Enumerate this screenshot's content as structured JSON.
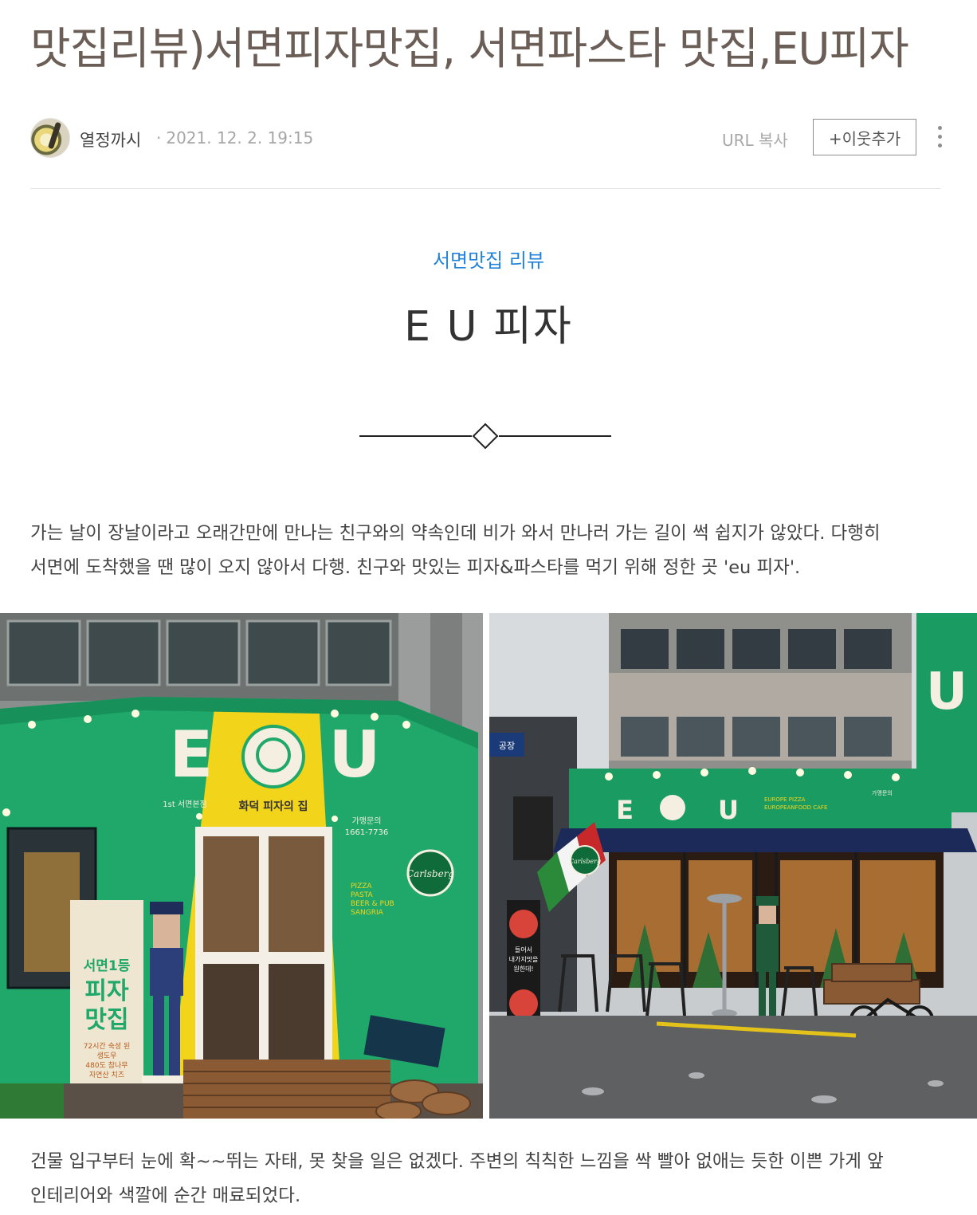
{
  "post": {
    "title": "맛집리뷰)서면피자맛집, 서면파스타 맛집,EU피자",
    "author": "열정까시",
    "date": "2021. 12.  2. 19:15",
    "date_separator": "·",
    "url_copy": "URL 복사",
    "follow_button": "+이웃추가"
  },
  "content": {
    "category": "서면맛집 리뷰",
    "store_name": "E U 피자",
    "paragraph1": [
      "가는 날이 장날이라고  오래간만에 만나는 친구와의 약속인데 비가 와서 만나러 가는 길이 썩 쉽지가 않았다. 다행히",
      "서면에 도착했을 땐  많이 오지 않아서 다행.  친구와  맛있는  피자&파스타를 먹기 위해 정한 곳 'eu 피자'."
    ],
    "paragraph2": [
      " 건물 입구부터 눈에 확~~뛰는 자태, 못 찾을 일은 없겠다. 주변의 칙칙한 느낌을 싹 빨아 없애는 듯한 이쁜 가게 앞",
      "인테리어와  색깔에 순간 매료되었다."
    ]
  },
  "photo1": {
    "letter_e": "E",
    "letter_u": "U",
    "branch": "1st 서면본점",
    "sign": "화덕 피자의 집",
    "phone_label": "가맹문의",
    "phone": "1661-7736",
    "menu": [
      "PIZZA",
      "PASTA",
      "BEER & PUB",
      "SANGRIA"
    ],
    "brand": "Carlsberg",
    "banner_top": "서면1등",
    "banner_mid": "피자",
    "banner_bot": "맛집",
    "banner_lines": [
      "72시간 숙성 된",
      "생도우",
      "480도 참나무",
      "자연산 치즈"
    ]
  },
  "photo2": {
    "letter_e": "E",
    "letter_u": "U",
    "sign_sub1": "EUROPE PIZZA",
    "sign_sub2": "EUROPEANFOOD CAFE",
    "sign_right": "가맹문의",
    "side_sign": "U",
    "brand": "Carlsberg",
    "banner": [
      "들어서",
      "내가지맛을",
      "원한데!"
    ],
    "left_sign": "공장"
  },
  "colors": {
    "title": "#6b5e57",
    "category": "#2383d8",
    "storefront_green": "#1fa86a",
    "storefront_yellow": "#f2d41a"
  },
  "icons": [
    "avatar",
    "more-vertical-icon",
    "diamond-divider-icon"
  ]
}
